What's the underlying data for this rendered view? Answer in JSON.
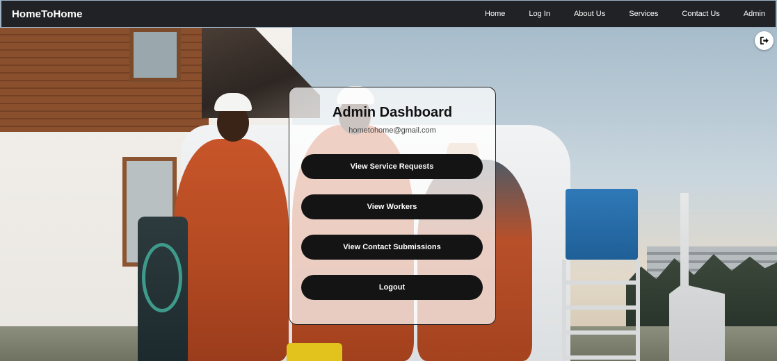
{
  "navbar": {
    "brand": "HomeToHome",
    "links": [
      "Home",
      "Log In",
      "About Us",
      "Services",
      "Contact Us",
      "Admin"
    ]
  },
  "floating_action": {
    "icon": "logout-icon"
  },
  "dashboard": {
    "title": "Admin Dashboard",
    "email": "hometohome@gmail.com",
    "buttons": [
      "View Service Requests",
      "View Workers",
      "View Contact Submissions",
      "Logout"
    ]
  },
  "colors": {
    "navbar_bg": "#212226",
    "button_bg": "#141414",
    "button_text": "#ffffff",
    "card_bg": "rgba(255,255,255,0.72)"
  }
}
